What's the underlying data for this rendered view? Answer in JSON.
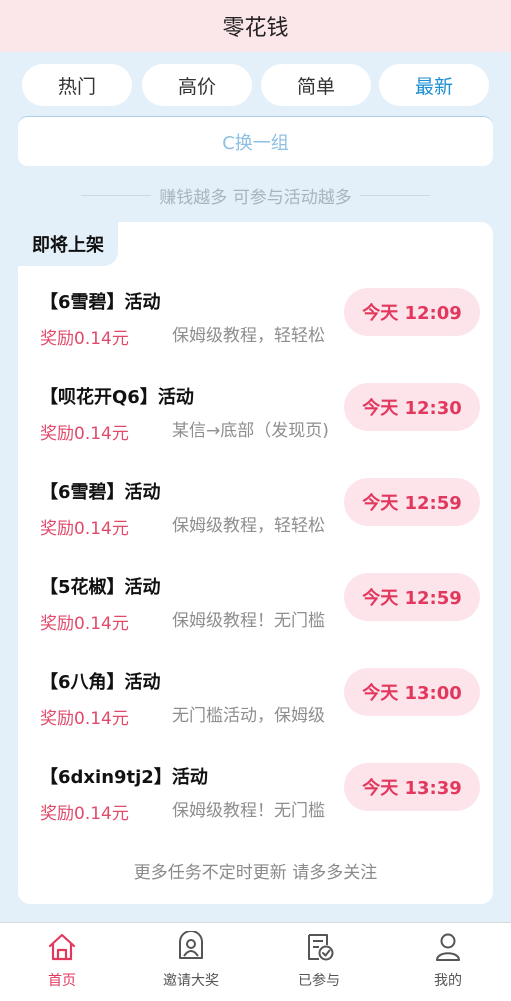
{
  "header": {
    "title": "零花钱"
  },
  "tabs": [
    {
      "label": "热门",
      "active": false
    },
    {
      "label": "高价",
      "active": false
    },
    {
      "label": "简单",
      "active": false
    },
    {
      "label": "最新",
      "active": true
    }
  ],
  "swap": {
    "label": "C换一组"
  },
  "slogan": {
    "text": "赚钱越多 可参与活动越多"
  },
  "section": {
    "title": "即将上架",
    "items": [
      {
        "name": "【6雪碧】活动",
        "reward": "奖励0.14元",
        "desc": "保姆级教程，轻轻松",
        "time": "今天 12:09"
      },
      {
        "name": "【呗花开Q6】活动",
        "reward": "奖励0.14元",
        "desc": "某信→底部（发现页)",
        "time": "今天 12:30"
      },
      {
        "name": "【6雪碧】活动",
        "reward": "奖励0.14元",
        "desc": "保姆级教程，轻轻松",
        "time": "今天 12:59"
      },
      {
        "name": "【5花椒】活动",
        "reward": "奖励0.14元",
        "desc": "保姆级教程！无门槛",
        "time": "今天 12:59"
      },
      {
        "name": "【6八角】活动",
        "reward": "奖励0.14元",
        "desc": "无门槛活动，保姆级",
        "time": "今天 13:00"
      },
      {
        "name": "【6dxin9tj2】活动",
        "reward": "奖励0.14元",
        "desc": "保姆级教程！无门槛",
        "time": "今天 13:39"
      }
    ],
    "footer_note": "更多任务不定时更新 请多多关注"
  },
  "nav": {
    "items": [
      {
        "label": "首页",
        "icon": "home-icon",
        "active": true
      },
      {
        "label": "邀请大奖",
        "icon": "invite-prize-icon",
        "active": false
      },
      {
        "label": "已参与",
        "icon": "participated-icon",
        "active": false
      },
      {
        "label": "我的",
        "icon": "profile-icon",
        "active": false
      }
    ]
  },
  "colors": {
    "accent": "#e2385e",
    "tab_active": "#1a8fd6",
    "background": "#e3f0f9",
    "header_bg": "#fbe6ea"
  }
}
